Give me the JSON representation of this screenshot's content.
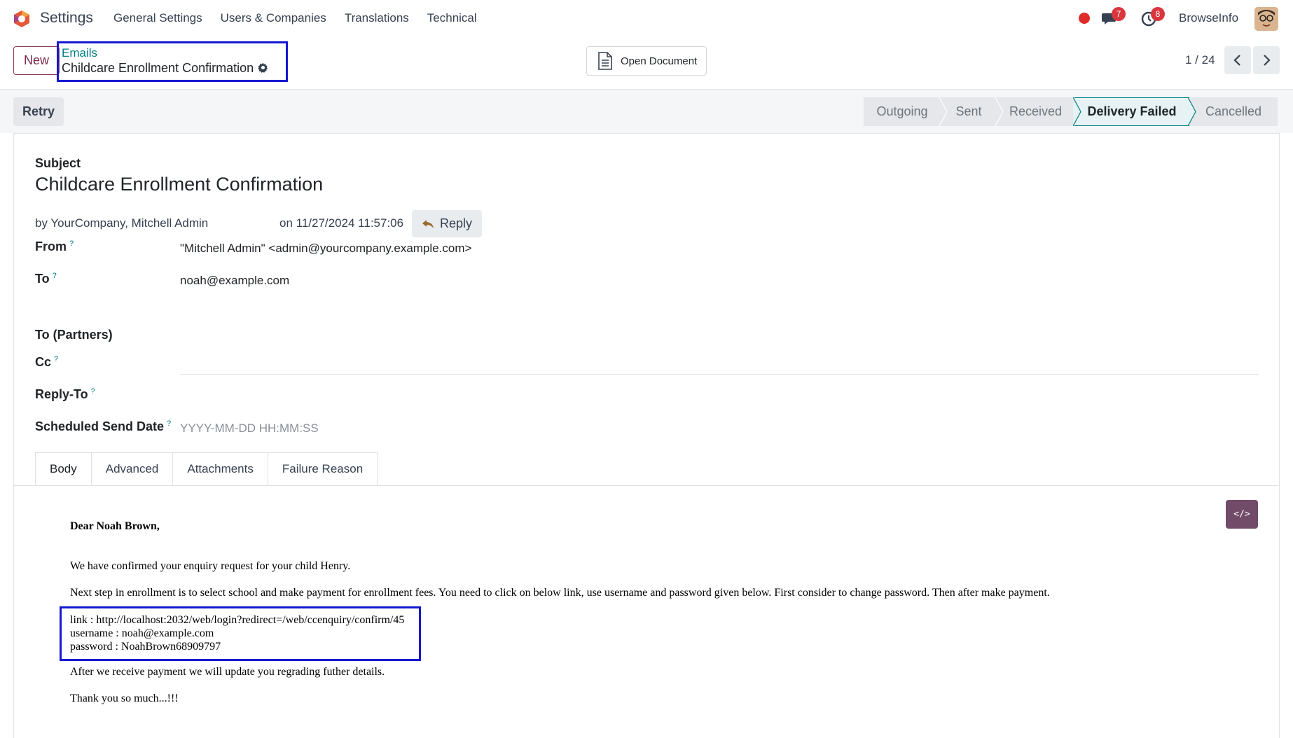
{
  "navbar": {
    "app_name": "Settings",
    "menu": [
      "General Settings",
      "Users & Companies",
      "Translations",
      "Technical"
    ],
    "messages_count": "7",
    "activities_count": "8",
    "company": "BrowseInfo",
    "icons": [
      "odoo-logo",
      "recording-dot",
      "chat-icon",
      "clock-icon",
      "avatar"
    ],
    "accent": "#714b67"
  },
  "control": {
    "new_label": "New",
    "breadcrumb_parent": "Emails",
    "record_title": "Childcare Enrollment Confirmation",
    "open_document_label": "Open Document",
    "pager": "1 / 24"
  },
  "status": {
    "retry_label": "Retry",
    "stages": [
      "Outgoing",
      "Sent",
      "Received",
      "Delivery Failed",
      "Cancelled"
    ],
    "active_stage": "Delivery Failed"
  },
  "form": {
    "subject_label": "Subject",
    "subject": "Childcare Enrollment Confirmation",
    "by": "by YourCompany, Mitchell Admin",
    "date": "on 11/27/2024 11:57:06",
    "reply_label": "Reply",
    "fields": {
      "from_label": "From",
      "from_value": "\"Mitchell Admin\" <admin@yourcompany.example.com>",
      "to_label": "To",
      "to_value": "noah@example.com",
      "to_partners_label": "To (Partners)",
      "cc_label": "Cc",
      "reply_to_label": "Reply-To",
      "scheduled_label": "Scheduled Send Date",
      "scheduled_placeholder": "YYYY-MM-DD HH:MM:SS",
      "help_mark": "?"
    },
    "tabs": [
      "Body",
      "Advanced",
      "Attachments",
      "Failure Reason"
    ],
    "active_tab": "Body"
  },
  "body": {
    "greeting": "Dear Noah Brown,",
    "p1": "We have confirmed your enquiry request for your child Henry.",
    "p2": "Next step in enrollment is to select school and make payment for enrollment fees. You need to click on below link, use username and password given below. First consider to change password. Then after make payment.",
    "link": "link : http://localhost:2032/web/login?redirect=/web/ccenquiry/confirm/45",
    "username": "username : noah@example.com",
    "password": "password : NoahBrown68909797",
    "p3": "After we receive payment we will update you regrading futher details.",
    "p4": "Thank you so much...!!!",
    "code_view_label": "</>"
  }
}
